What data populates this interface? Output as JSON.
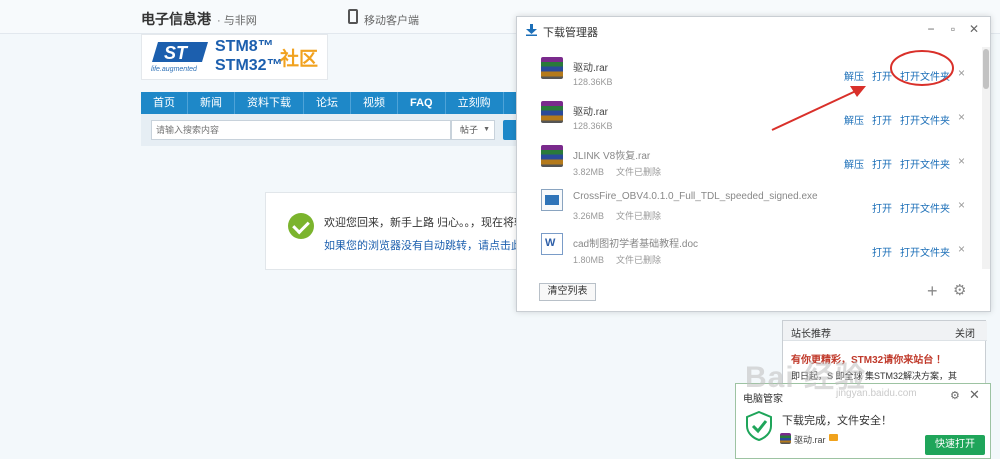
{
  "site": {
    "name": "电子信息港",
    "sub": "· 与非网",
    "mobile_label": "移动客户端"
  },
  "logo": {
    "tagline": "life.augmented",
    "stm8": "STM8™",
    "stm32": "STM32™",
    "community": "社区"
  },
  "nav": {
    "items": [
      {
        "label": "首页"
      },
      {
        "label": "新闻"
      },
      {
        "label": "资料下载"
      },
      {
        "label": "论坛"
      },
      {
        "label": "视频"
      },
      {
        "label": "FAQ"
      },
      {
        "label": "立刻购"
      }
    ]
  },
  "search": {
    "placeholder": "请输入搜索内容",
    "scope": "帖子"
  },
  "welcome": {
    "line1": "欢迎您回来，新手上路 归心。。，现在将转",
    "line2": "如果您的浏览器没有自动跳转，请点击此链"
  },
  "download_manager": {
    "title": "下载管理器",
    "files": [
      {
        "name": "驱动.rar",
        "size": "128.36KB",
        "status": "",
        "extract": "解压",
        "open": "打开",
        "open_folder": "打开文件夹",
        "icon": "rar-icon"
      },
      {
        "name": "驱动.rar",
        "size": "128.36KB",
        "status": "",
        "extract": "解压",
        "open": "打开",
        "open_folder": "打开文件夹",
        "icon": "rar-icon"
      },
      {
        "name": "JLINK V8恢复.rar",
        "size": "3.82MB",
        "status": "文件已删除",
        "extract": "解压",
        "open": "打开",
        "open_folder": "打开文件夹",
        "icon": "rar-icon"
      },
      {
        "name": "CrossFire_OBV4.0.1.0_Full_TDL_speeded_signed.exe",
        "size": "3.26MB",
        "status": "文件已删除",
        "extract": "",
        "open": "打开",
        "open_folder": "打开文件夹",
        "icon": "exe-icon"
      },
      {
        "name": "cad制图初学者基础教程.doc",
        "size": "1.80MB",
        "status": "文件已删除",
        "extract": "",
        "open": "打开",
        "open_folder": "打开文件夹",
        "icon": "doc-icon"
      }
    ],
    "clear_label": "清空列表"
  },
  "recommendation": {
    "title": "站长推荐",
    "close_label": "关闭",
    "headline": "有你更精彩，STM32请你来站台 ！",
    "body": "即日起，S  即全球 集STM32解决方案，其"
  },
  "security_toast": {
    "title": "电脑管家",
    "message": "下载完成，文件安全！",
    "file": "驱动.rar",
    "button_label": "快速打开"
  },
  "watermark": {
    "text": "Bai 经验",
    "url": "jingyan.baidu.com"
  },
  "colors": {
    "nav_blue": "#1e88c8",
    "link_blue": "#1c6fb8",
    "annotation_red": "#d9302a",
    "safe_green": "#1fa55a"
  }
}
